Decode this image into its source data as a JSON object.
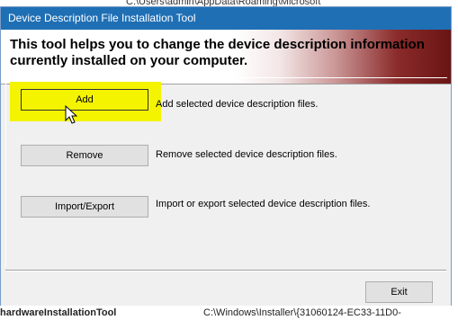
{
  "background": {
    "top_text": "C:\\Users\\admin\\AppData\\Roaming\\Microsoft",
    "bottom_left_text": "hardwareInstallationTool",
    "bottom_right_text": "C:\\Windows\\Installer\\{31060124-EC33-11D0-"
  },
  "dialog": {
    "title": "Device Description File Installation Tool",
    "banner_text": "This tool helps you to change the device description information currently installed on your computer.",
    "actions": [
      {
        "label": "Add",
        "description": "Add selected device description files."
      },
      {
        "label": "Remove",
        "description": "Remove selected device description files."
      },
      {
        "label": "Import/Export",
        "description": "Import or export selected device description files."
      }
    ],
    "exit_label": "Exit"
  },
  "colors": {
    "highlight": "#f4f400",
    "titlebar": "#1f6fb5"
  },
  "icons": {
    "cursor": "mouse-pointer-icon"
  }
}
